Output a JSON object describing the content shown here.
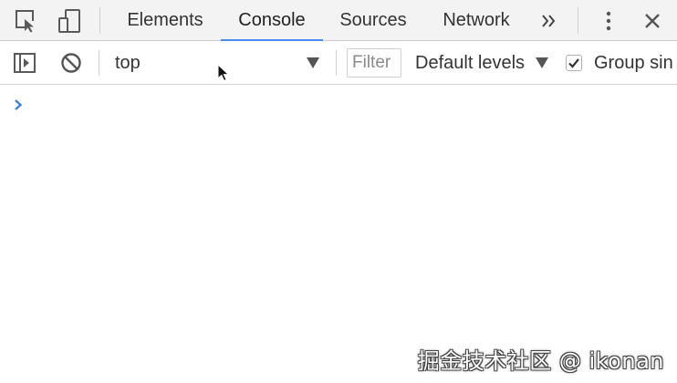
{
  "tabs": [
    {
      "label": "Elements"
    },
    {
      "label": "Console",
      "active": true
    },
    {
      "label": "Sources"
    },
    {
      "label": "Network"
    }
  ],
  "toolbar": {
    "context": "top",
    "filter_placeholder": "Filter",
    "levels_label": "Default levels",
    "group_similar_label": "Group sin",
    "group_similar_checked": true
  },
  "console": {
    "prompt_input": ""
  },
  "icons": {
    "inspect": "element-picker-icon",
    "device": "device-toolbar-icon",
    "more_tabs": "chevron-double-right-icon",
    "menu": "kebab-menu-icon",
    "close": "close-icon",
    "sidebar": "console-sidebar-icon",
    "clear": "clear-console-icon",
    "prompt": "chevron-right-icon",
    "pointer": "mouse-pointer-icon"
  },
  "colors": {
    "tabbar_bg": "#f3f3f3",
    "active_tab_underline": "#4a8af4",
    "prompt_chevron": "#3b82e0",
    "icon": "#5a5a5a"
  },
  "watermark": "掘金技术社区 @ ikonan"
}
